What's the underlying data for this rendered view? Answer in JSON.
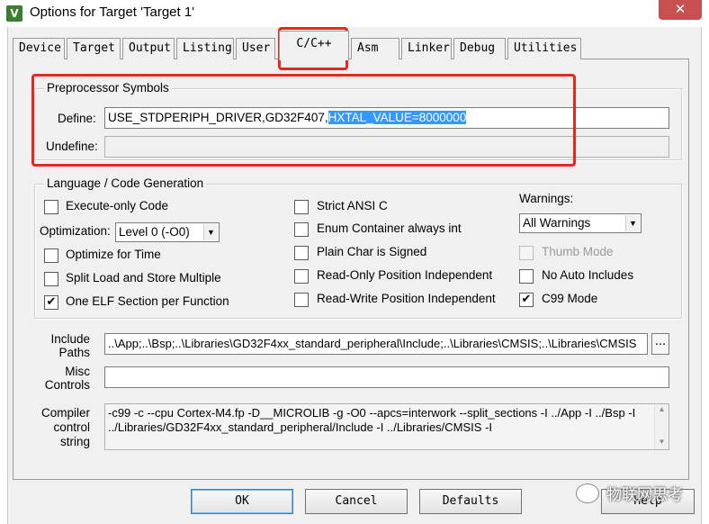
{
  "window": {
    "title": "Options for Target 'Target 1'",
    "icon_glyph": "V",
    "close_glyph": "✕"
  },
  "tabs": [
    {
      "label": "Device"
    },
    {
      "label": "Target"
    },
    {
      "label": "Output"
    },
    {
      "label": "Listing"
    },
    {
      "label": "User"
    },
    {
      "label": "C/C++"
    },
    {
      "label": "Asm"
    },
    {
      "label": "Linker"
    },
    {
      "label": "Debug"
    },
    {
      "label": "Utilities"
    }
  ],
  "active_tab": "C/C++",
  "preprocessor": {
    "group_title": "Preprocessor Symbols",
    "define_label": "Define:",
    "define_value_plain": "USE_STDPERIPH_DRIVER,GD32F407,",
    "define_value_selected": "HXTAL_VALUE=8000000",
    "undefine_label": "Undefine:",
    "undefine_value": ""
  },
  "language": {
    "group_title": "Language / Code Generation",
    "execute_only": {
      "label": "Execute-only Code",
      "checked": false
    },
    "optimization_label": "Optimization:",
    "optimization_value": "Level 0 (-O0)",
    "optimize_time": {
      "label": "Optimize for Time",
      "checked": false
    },
    "split_load": {
      "label": "Split Load and Store Multiple",
      "checked": false
    },
    "one_elf": {
      "label": "One ELF Section per Function",
      "checked": true
    },
    "strict_ansi": {
      "label": "Strict ANSI C",
      "checked": false
    },
    "enum_container": {
      "label": "Enum Container always int",
      "checked": false
    },
    "plain_char": {
      "label": "Plain Char is Signed",
      "checked": false
    },
    "ro_position": {
      "label": "Read-Only Position Independent",
      "checked": false
    },
    "rw_position": {
      "label": "Read-Write Position Independent",
      "checked": false
    },
    "warnings_label": "Warnings:",
    "warnings_value": "All Warnings",
    "thumb_mode": {
      "label": "Thumb Mode",
      "checked": false,
      "disabled": true
    },
    "no_auto_includes": {
      "label": "No Auto Includes",
      "checked": false
    },
    "c99_mode": {
      "label": "C99 Mode",
      "checked": true
    }
  },
  "include_paths": {
    "label_line1": "Include",
    "label_line2": "Paths",
    "value": "..\\App;..\\Bsp;..\\Libraries\\GD32F4xx_standard_peripheral\\Include;..\\Libraries\\CMSIS;..\\Libraries\\CMSIS",
    "browse_label": "..."
  },
  "misc_controls": {
    "label_line1": "Misc",
    "label_line2": "Controls",
    "value": ""
  },
  "compiler_string": {
    "label_line1": "Compiler",
    "label_line2": "control",
    "label_line3": "string",
    "line1": "-c99 -c --cpu Cortex-M4.fp -D__MICROLIB -g -O0 --apcs=interwork --split_sections -I ../App -I ../Bsp -I",
    "line2": "../Libraries/GD32F4xx_standard_peripheral/Include -I ../Libraries/CMSIS -I"
  },
  "buttons": {
    "ok": "OK",
    "cancel": "Cancel",
    "defaults": "Defaults",
    "help": "Help"
  },
  "watermark": {
    "text": "物联网思考"
  },
  "colors": {
    "highlight": "#e8281e",
    "selection": "#3399ff",
    "dialog_bg": "#f0f0f0"
  }
}
